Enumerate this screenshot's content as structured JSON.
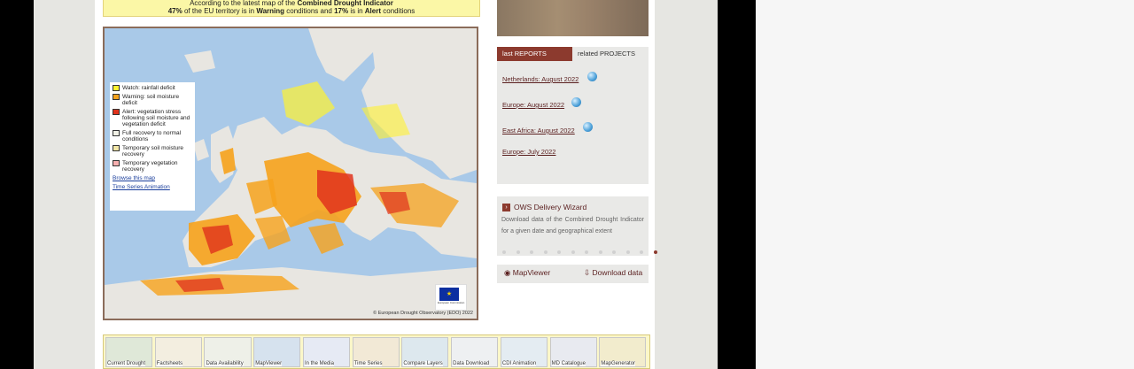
{
  "notice": {
    "line1_prefix": "According to the latest map of the ",
    "line1_bold": "Combined Drought Indicator",
    "line2_pct1": "47%",
    "line2_mid1": " of the EU territory is in ",
    "line2_warn": "Warning",
    "line2_mid2": " conditions and ",
    "line2_pct2": "17%",
    "line2_mid3": " is in ",
    "line2_alert": "Alert",
    "line2_end": " conditions"
  },
  "legend": {
    "items": [
      {
        "label": "Watch: rainfall deficit",
        "color": "#fff230"
      },
      {
        "label": "Warning: soil moisture deficit",
        "color": "#f6a21c"
      },
      {
        "label": "Alert: vegetation stress following soil moisture and vegetation deficit",
        "color": "#e0321c"
      },
      {
        "label": "Full recovery to normal conditions",
        "color": "#f1f1e6"
      },
      {
        "label": "Temporary soil moisture recovery",
        "color": "#f3e7a7"
      },
      {
        "label": "Temporary vegetation recovery",
        "color": "#f7b0b0"
      }
    ],
    "browse_link": "Browse this map",
    "timeseries_link": "Time Series Animation"
  },
  "map": {
    "copyright": "© European Drought Observatory (EDO) 2022",
    "eu_badge_text": "European Commission"
  },
  "reports": {
    "tab_active": "last REPORTS",
    "tab_inactive": "related PROJECTS",
    "links": [
      "Netherlands: August 2022",
      "Europe: August 2022",
      "East Africa: August 2022",
      "Europe: July 2022"
    ]
  },
  "ows": {
    "title": "OWS Delivery Wizard",
    "description": "Download data of the Combined Drought Indicator for a given date and geographical extent",
    "dot_count": 12,
    "active_dot": 11
  },
  "buttons": {
    "mapviewer": "MapViewer",
    "download": "Download data"
  },
  "thumbs": [
    "Current Drought",
    "Factsheets",
    "Data Availability",
    "MapViewer",
    "In the Media",
    "Time Series",
    "Compare Layers",
    "Data Download",
    "CDI Animation",
    "MD Catalogue",
    "MapGenerator"
  ],
  "colors": {
    "accent": "#8c3a2e",
    "link": "#5a1f1f"
  }
}
